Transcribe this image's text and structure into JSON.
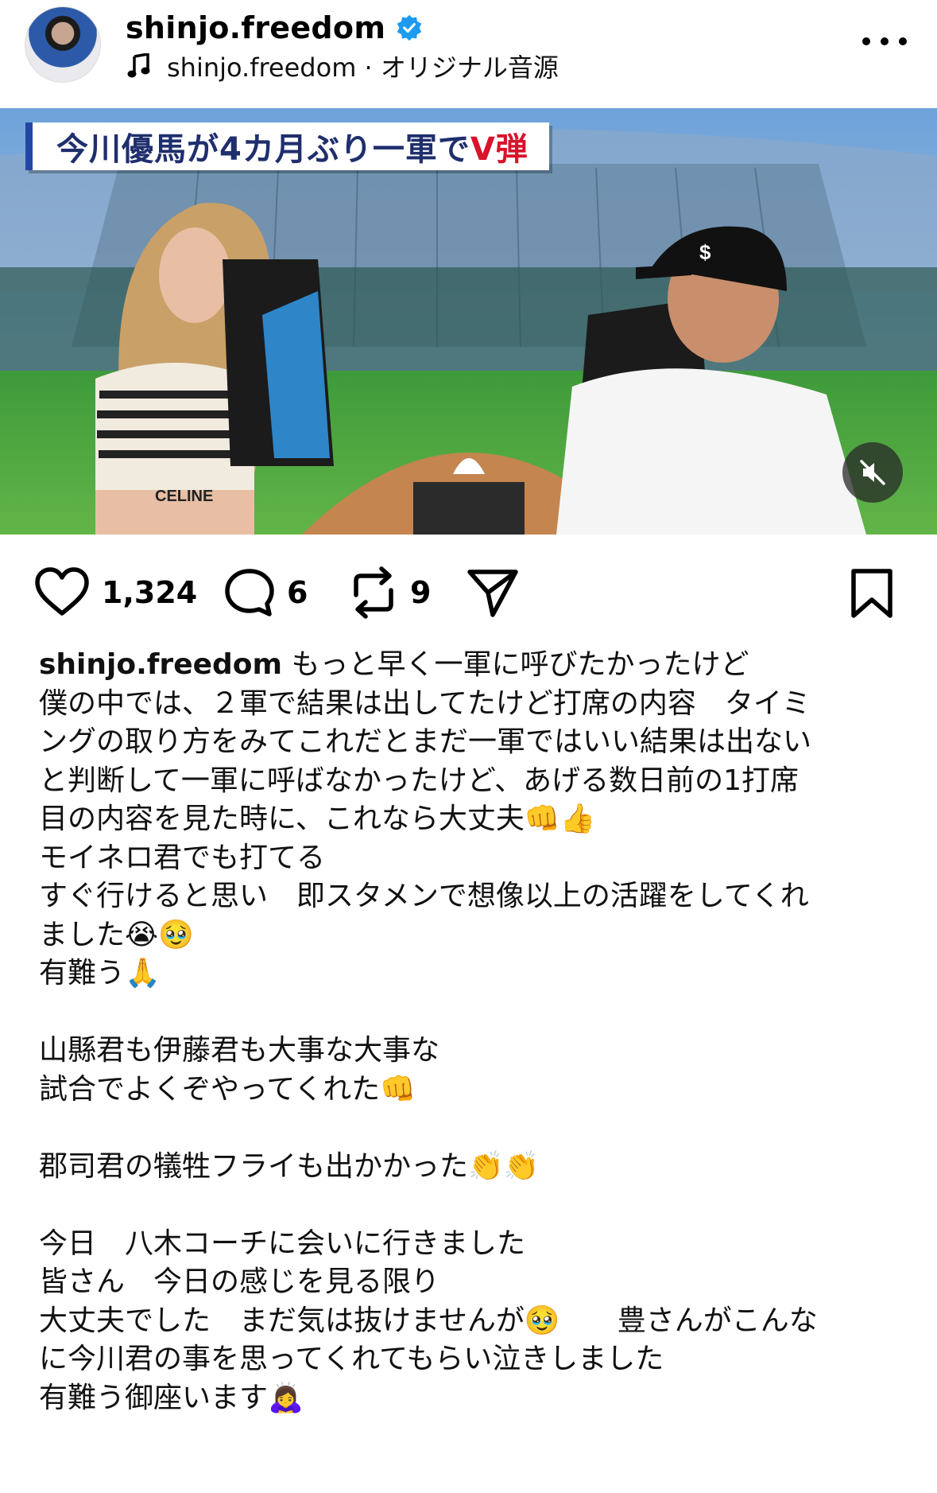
{
  "header": {
    "username": "shinjo.freedom",
    "audio_label": "shinjo.freedom · オリジナル音源",
    "verified_icon": "verified-badge-icon",
    "more_icon": "more-options-icon"
  },
  "media": {
    "banner_prefix": "今川優馬が4カ月ぶり一軍で",
    "banner_accent": "V弾",
    "shirt_text": "CELINE",
    "mute_icon": "speaker-muted-icon"
  },
  "actions": {
    "likes": "1,324",
    "comments": "6",
    "reposts": "9"
  },
  "caption": {
    "handle": "shinjo.freedom",
    "first_line": " もっと早く一軍に呼びたかったけど",
    "lines": [
      "僕の中では、２軍で結果は出してたけど打席の内容　タイミ",
      "ングの取り方をみてこれだとまだ一軍ではいい結果は出ない",
      "と判断して一軍に呼ばなかったけど、あげる数日前の1打席",
      "目の内容を見た時に、これなら大丈夫👊👍",
      "モイネロ君でも打てる",
      "すぐ行けると思い　即スタメンで想像以上の活躍をしてくれ",
      "ました😭🥹",
      "有難う🙏",
      "",
      "山縣君も伊藤君も大事な大事な",
      "試合でよくぞやってくれた👊",
      "",
      "郡司君の犠牲フライも出かかった👏👏",
      "",
      "今日　八木コーチに会いに行きました",
      "皆さん　今日の感じを見る限り",
      "大丈夫でした　まだ気は抜けませんが🥹　　豊さんがこんな",
      "に今川君の事を思ってくれてもらい泣きしました",
      "有難う御座います🙇‍♀️"
    ]
  }
}
